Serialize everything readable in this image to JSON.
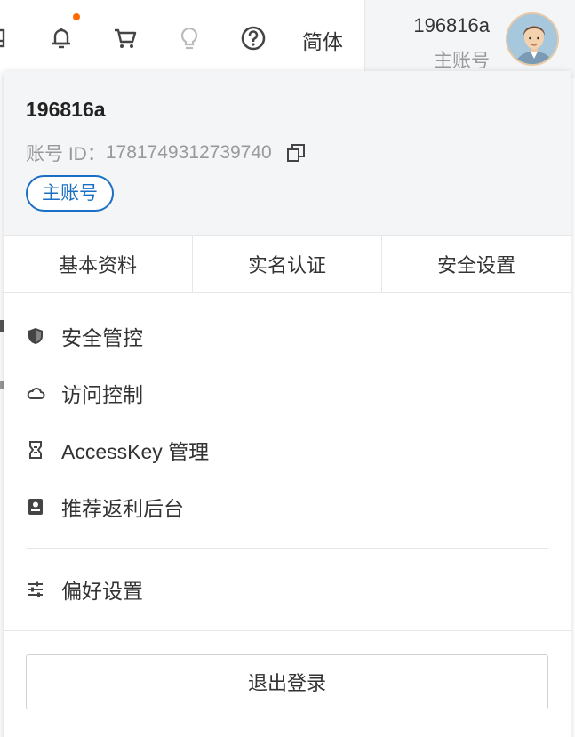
{
  "topbar": {
    "icons": [
      "document-icon",
      "bell-icon",
      "cart-icon",
      "lightbulb-icon",
      "help-icon"
    ],
    "lang_label": "简体"
  },
  "user": {
    "name": "196816a",
    "role": "主账号"
  },
  "panel": {
    "account_name": "196816a",
    "account_id_label": "账号 ID：",
    "account_id": "1781749312739740",
    "role_badge": "主账号",
    "tabs": [
      {
        "label": "基本资料"
      },
      {
        "label": "实名认证"
      },
      {
        "label": "安全设置"
      }
    ],
    "menu": [
      {
        "label": "安全管控",
        "icon": "shield-icon"
      },
      {
        "label": "访问控制",
        "icon": "cloud-icon"
      },
      {
        "label": "AccessKey 管理",
        "icon": "key-icon"
      },
      {
        "label": "推荐返利后台",
        "icon": "rebate-icon"
      }
    ],
    "prefs": {
      "label": "偏好设置",
      "icon": "sliders-icon"
    },
    "logout_label": "退出登录"
  },
  "colors": {
    "accent_blue": "#1a6fc4",
    "notification_dot": "#ff6a00",
    "header_bg": "#f4f5f7"
  }
}
